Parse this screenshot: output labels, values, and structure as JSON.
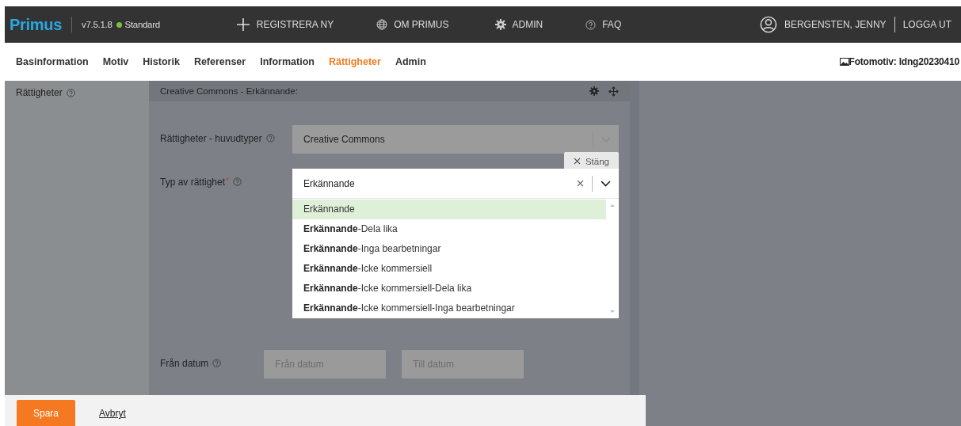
{
  "topbar": {
    "logo": "Primus",
    "version": "v7.5.1.8",
    "status": {
      "label": "Standard",
      "color": "#7bc043"
    },
    "menu": [
      {
        "kind": "plus",
        "label": "REGISTRERA NY"
      },
      {
        "kind": "globe",
        "label": "OM PRIMUS"
      },
      {
        "kind": "gear",
        "label": "ADMIN"
      },
      {
        "kind": "help",
        "label": "FAQ"
      }
    ],
    "user": "BERGENSTEN, JENNY",
    "logout": "LOGGA UT"
  },
  "tabs": [
    {
      "label": "Basinformation",
      "selected": false
    },
    {
      "label": "Motiv",
      "selected": false
    },
    {
      "label": "Historik",
      "selected": false
    },
    {
      "label": "Referenser",
      "selected": false
    },
    {
      "label": "Information",
      "selected": false
    },
    {
      "label": "Rättigheter",
      "selected": true
    },
    {
      "label": "Admin",
      "selected": false
    }
  ],
  "record": "Fotomotiv: ldng20230410",
  "sidebar": {
    "label": "Rättigheter"
  },
  "panel": {
    "title": "Creative Commons - Erkännande:",
    "main_type": {
      "label": "Rättigheter - huvudtyper",
      "value": "Creative Commons"
    },
    "close_button": "Stäng",
    "type": {
      "label": "Typ av rättighet",
      "required_mark": "*",
      "value": "Erkännande",
      "expanded": true,
      "options": [
        {
          "label": "Erkännande",
          "selected": true
        },
        {
          "label": "**Erkännande**-Dela lika",
          "selected": false
        },
        {
          "label": "**Erkännande**-Inga bearbetningar",
          "selected": false
        },
        {
          "label": "**Erkännande**-Icke kommersiell",
          "selected": false
        },
        {
          "label": "**Erkännande**-Icke kommersiell-Dela lika",
          "selected": false
        },
        {
          "label": "**Erkännande**-Icke kommersiell-Inga bearbetningar",
          "selected": false
        }
      ]
    },
    "dates": {
      "label": "Från datum",
      "from_placeholder": "Från datum",
      "to_placeholder": "Till datum"
    }
  },
  "footer": {
    "save": "Spara",
    "cancel": "Avbryt"
  }
}
